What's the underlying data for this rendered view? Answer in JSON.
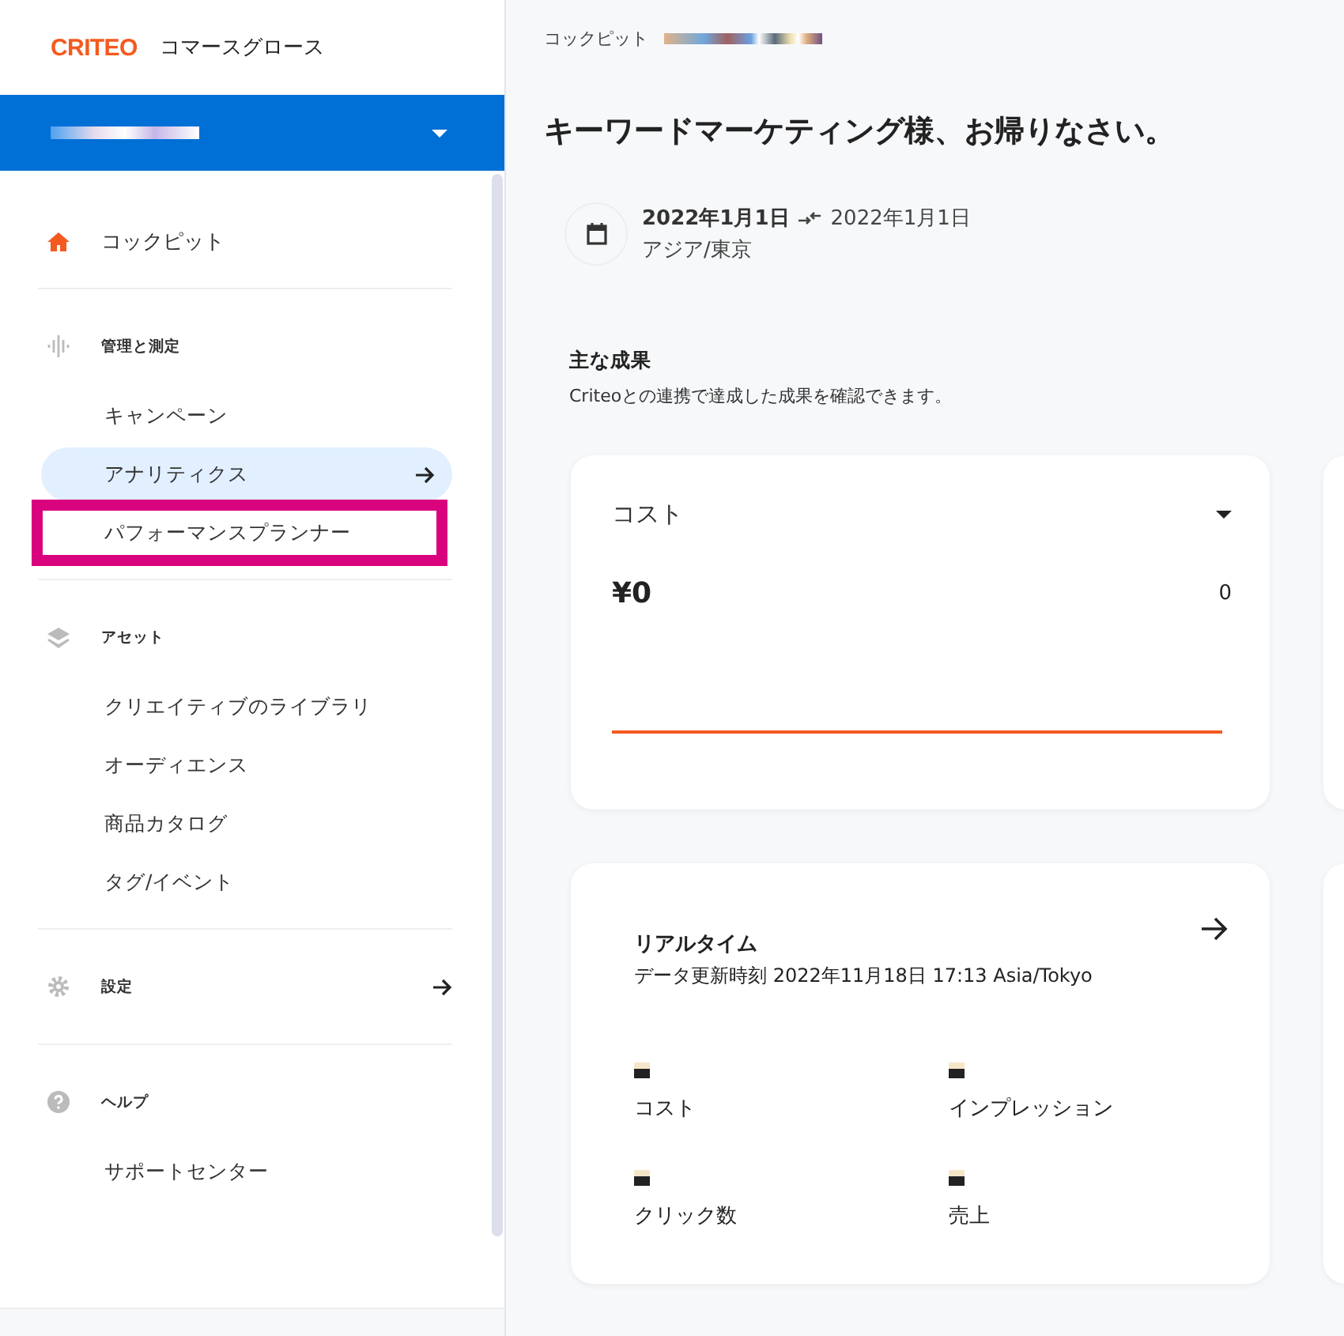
{
  "brand": {
    "logo": "CRITEO",
    "product": "コマースグロース"
  },
  "sidebar": {
    "sections": [
      {
        "kind": "link",
        "label": "コックピット",
        "arrow": false
      },
      {
        "kind": "group",
        "label": "管理と測定",
        "arrow": false,
        "items": [
          {
            "label": "キャンペーン",
            "selected": false,
            "highlighted": false,
            "arrow": false
          },
          {
            "label": "アナリティクス",
            "selected": true,
            "highlighted": false,
            "arrow": true
          },
          {
            "label": "パフォーマンスプランナー",
            "selected": false,
            "highlighted": true,
            "arrow": false
          }
        ]
      },
      {
        "kind": "group",
        "label": "アセット",
        "arrow": false,
        "items": [
          {
            "label": "クリエイティブのライブラリ",
            "selected": false,
            "highlighted": false,
            "arrow": false
          },
          {
            "label": "オーディエンス",
            "selected": false,
            "highlighted": false,
            "arrow": false
          },
          {
            "label": "商品カタログ",
            "selected": false,
            "highlighted": false,
            "arrow": false
          },
          {
            "label": "タグ/イベント",
            "selected": false,
            "highlighted": false,
            "arrow": false
          }
        ]
      },
      {
        "kind": "group",
        "label": "設定",
        "arrow": true
      },
      {
        "kind": "group",
        "label": "ヘルプ",
        "arrow": false,
        "items": [
          {
            "label": "サポートセンター",
            "selected": false,
            "highlighted": false,
            "arrow": false
          }
        ]
      }
    ]
  },
  "breadcrumb": "コックピット",
  "title": "キーワードマーケティング様、お帰りなさい。",
  "date_range": {
    "start": "2022年1月1日",
    "end": "2022年1月1日",
    "timezone": "アジア/東京"
  },
  "results": {
    "title": "主な成果",
    "subtitle": "Criteoとの連携で達成した成果を確認できます。"
  },
  "cost_card": {
    "metric": "コスト",
    "value": "¥0",
    "reading": "0"
  },
  "realtime": {
    "title": "リアルタイム",
    "updated": "データ更新時刻 2022年11月18日 17:13 Asia/Tokyo",
    "metrics": [
      {
        "label": "コスト"
      },
      {
        "label": "インプレッション"
      },
      {
        "label": "クリック数"
      },
      {
        "label": "売上"
      }
    ]
  }
}
